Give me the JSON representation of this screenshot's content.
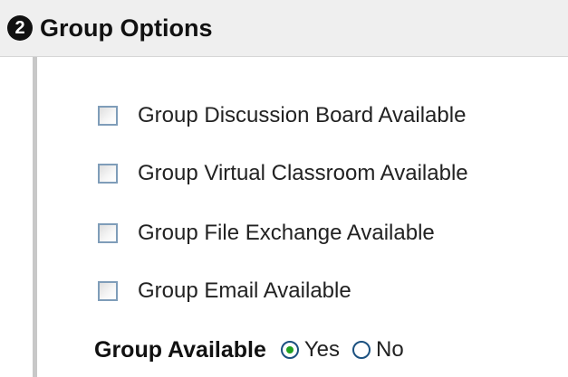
{
  "section": {
    "step_number": "2",
    "title": "Group Options"
  },
  "options": [
    {
      "label": "Group Discussion Board Available",
      "checked": false
    },
    {
      "label": "Group Virtual Classroom Available",
      "checked": false
    },
    {
      "label": "Group File Exchange Available",
      "checked": false
    },
    {
      "label": "Group Email Available",
      "checked": false
    }
  ],
  "group_available": {
    "label": "Group Available",
    "yes_label": "Yes",
    "no_label": "No",
    "selected": "Yes"
  },
  "colors": {
    "header_background": "#efefef",
    "checkbox_border": "#7f9db9",
    "radio_dot": "#21a121"
  }
}
